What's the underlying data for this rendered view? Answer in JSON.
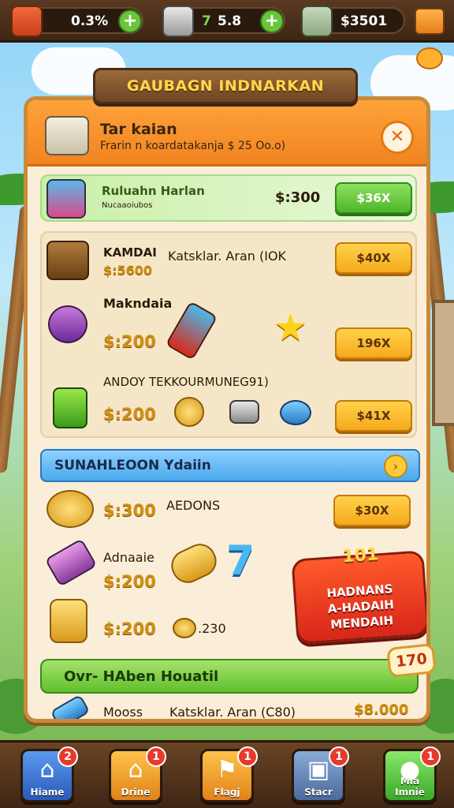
{
  "topbar": {
    "resource1": {
      "value": "0.3%",
      "icon": "crate-icon"
    },
    "resource2": {
      "value": "5.8",
      "icon": "dice-icon",
      "prefix": "7"
    },
    "resource3": {
      "value": "$3501",
      "icon": "cash-stack-icon"
    },
    "plus_label": "+"
  },
  "banner": {
    "title": "GAUBAGN INDNARKAN"
  },
  "panel": {
    "title": "Tar kaian",
    "subtitle": "Frarin n koardatakanja  $ 25 Oo.o)",
    "close_label": "✕"
  },
  "featured": {
    "title": "Ruluahn Harlan",
    "sub": "Nucaaoiubos",
    "price": "$:300",
    "button": "$36X"
  },
  "section1": {
    "row1": {
      "name": "KAMDAI",
      "price": "$:5600",
      "desc": "Katsklar. Aran (IOK",
      "button": "$40X"
    },
    "row2": {
      "name": "Makndaia",
      "price": "$:200",
      "button": "196X"
    },
    "row3": {
      "heading": "ANDOY TEKKOURMUNEG91)",
      "price": "$:200",
      "button": "$41X"
    }
  },
  "blue_section": {
    "title": "SUNAHLEOON Ydaiin",
    "info_label": "›"
  },
  "section2": {
    "row1": {
      "price": "$:300",
      "name": "AEDONS",
      "button": "$30X"
    },
    "row2": {
      "name": "Adnaaie",
      "price": "$:200",
      "glyph": "7"
    },
    "row3": {
      "price": "$:200",
      "note": ".230"
    }
  },
  "burst": {
    "number": "101",
    "line1": "HADNANS",
    "line2": "A-HADAIH",
    "line3": "MENDAIH"
  },
  "green_section": {
    "title": "Ovr- HAben Houatil",
    "badge": "170"
  },
  "footer_row": {
    "name": "Mooss",
    "desc": "Katsklar. Aran (C80)",
    "price": "$8.000"
  },
  "bottom_nav": [
    {
      "label": "Hiame",
      "badge": "2",
      "icon": "home-icon",
      "color": "#3a7ad8"
    },
    {
      "label": "Drine",
      "badge": "1",
      "icon": "shop-icon",
      "color": "#f0a02a"
    },
    {
      "label": "Flagj",
      "badge": "1",
      "icon": "flag-icon",
      "color": "#f0a02a"
    },
    {
      "label": "Stacr",
      "badge": "1",
      "icon": "chest-icon",
      "color": "#6a8ab8"
    },
    {
      "label": "Mla Imnie",
      "badge": "1",
      "icon": "chat-icon",
      "color": "#5ac43a"
    }
  ],
  "colors": {
    "accent_orange": "#f08420",
    "gold": "#d09010",
    "green": "#4fb52a",
    "blue": "#4aa8ec",
    "red": "#d8261a"
  }
}
